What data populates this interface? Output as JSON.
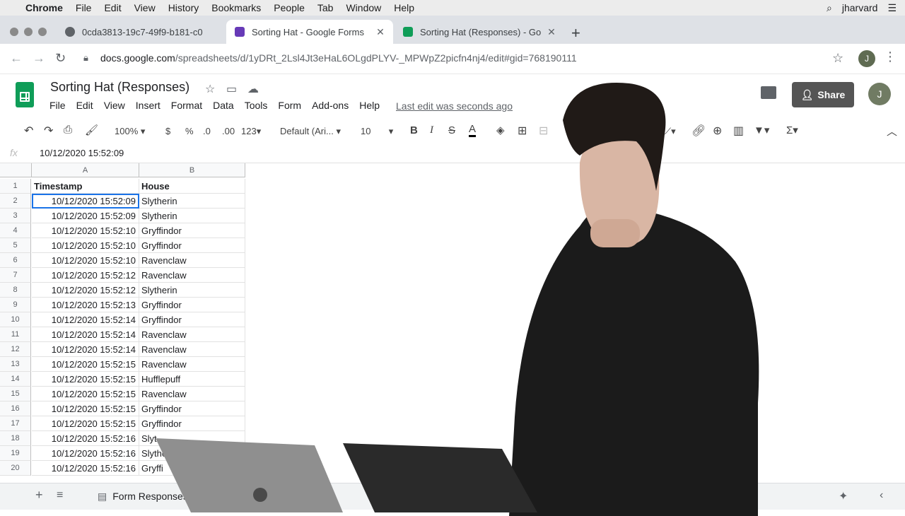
{
  "menubar": {
    "app": "Chrome",
    "items": [
      "File",
      "Edit",
      "View",
      "History",
      "Bookmarks",
      "People",
      "Tab",
      "Window",
      "Help"
    ],
    "user": "jharvard"
  },
  "tabs": [
    {
      "title": "0cda3813-19c7-49f9-b181-c0",
      "active": false
    },
    {
      "title": "Sorting Hat - Google Forms",
      "active": true
    },
    {
      "title": "Sorting Hat (Responses) - Go",
      "active": false
    }
  ],
  "omnibox": {
    "host": "docs.google.com",
    "path": "/spreadsheets/d/1yDRt_2Lsl4Jt3eHaL6OLgdPLYV-_MPWpZ2picfn4nj4/edit#gid=768190111",
    "avatar": "J"
  },
  "sheet": {
    "title": "Sorting Hat (Responses)",
    "menu": [
      "File",
      "Edit",
      "View",
      "Insert",
      "Format",
      "Data",
      "Tools",
      "Form",
      "Add-ons",
      "Help"
    ],
    "last_edit": "Last edit was seconds ago",
    "share_label": "Share",
    "avatar": "J"
  },
  "format_toolbar": {
    "zoom": "100%",
    "currency": "$",
    "percent": "%",
    "dec_less": ".0",
    "dec_more": ".00",
    "more_formats": "123",
    "font": "Default (Ari...",
    "font_size": "10"
  },
  "formula_bar": {
    "fx": "fx",
    "value": "10/12/2020 15:52:09"
  },
  "grid": {
    "columns": [
      "A",
      "B"
    ],
    "header": {
      "timestamp": "Timestamp",
      "house": "House"
    },
    "rows": [
      {
        "n": "2",
        "timestamp": "10/12/2020 15:52:09",
        "house": "Slytherin"
      },
      {
        "n": "3",
        "timestamp": "10/12/2020 15:52:09",
        "house": "Slytherin"
      },
      {
        "n": "4",
        "timestamp": "10/12/2020 15:52:10",
        "house": "Gryffindor"
      },
      {
        "n": "5",
        "timestamp": "10/12/2020 15:52:10",
        "house": "Gryffindor"
      },
      {
        "n": "6",
        "timestamp": "10/12/2020 15:52:10",
        "house": "Ravenclaw"
      },
      {
        "n": "7",
        "timestamp": "10/12/2020 15:52:12",
        "house": "Ravenclaw"
      },
      {
        "n": "8",
        "timestamp": "10/12/2020 15:52:12",
        "house": "Slytherin"
      },
      {
        "n": "9",
        "timestamp": "10/12/2020 15:52:13",
        "house": "Gryffindor"
      },
      {
        "n": "10",
        "timestamp": "10/12/2020 15:52:14",
        "house": "Gryffindor"
      },
      {
        "n": "11",
        "timestamp": "10/12/2020 15:52:14",
        "house": "Ravenclaw"
      },
      {
        "n": "12",
        "timestamp": "10/12/2020 15:52:14",
        "house": "Ravenclaw"
      },
      {
        "n": "13",
        "timestamp": "10/12/2020 15:52:15",
        "house": "Ravenclaw"
      },
      {
        "n": "14",
        "timestamp": "10/12/2020 15:52:15",
        "house": "Hufflepuff"
      },
      {
        "n": "15",
        "timestamp": "10/12/2020 15:52:15",
        "house": "Ravenclaw"
      },
      {
        "n": "16",
        "timestamp": "10/12/2020 15:52:15",
        "house": "Gryffindor"
      },
      {
        "n": "17",
        "timestamp": "10/12/2020 15:52:15",
        "house": "Gryffindor"
      },
      {
        "n": "18",
        "timestamp": "10/12/2020 15:52:16",
        "house": "Slyt"
      },
      {
        "n": "19",
        "timestamp": "10/12/2020 15:52:16",
        "house": "Slythe"
      },
      {
        "n": "20",
        "timestamp": "10/12/2020 15:52:16",
        "house": "Gryffi"
      }
    ]
  },
  "bottom_bar": {
    "sheet_tab": "Form Responses"
  }
}
